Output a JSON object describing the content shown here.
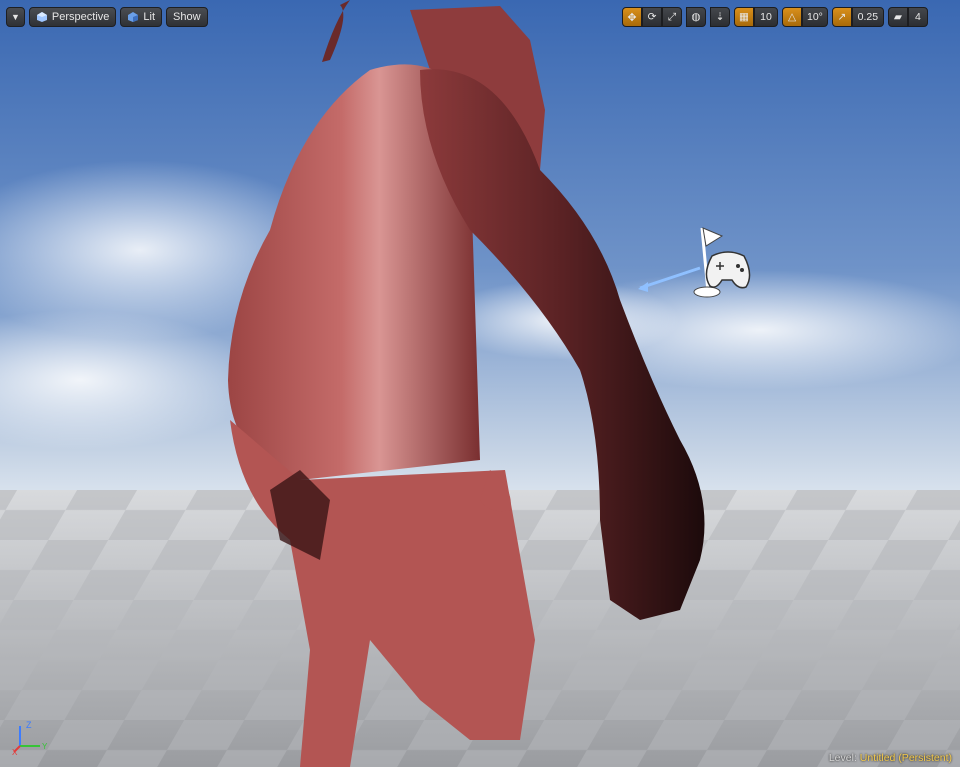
{
  "toolbar_left": {
    "menu_icon": "chevron-down-icon",
    "perspective_label": "Perspective",
    "lit_label": "Lit",
    "show_label": "Show"
  },
  "toolbar_right": {
    "grid_snap_value": "10",
    "rotation_snap_value": "10°",
    "scale_snap_value": "0.25",
    "camera_speed_value": "4"
  },
  "axis": {
    "z": "Z",
    "x": "X",
    "y": "Y"
  },
  "level": {
    "label": "Level:",
    "name": "Untitled (Persistent)"
  },
  "colors": {
    "sky_top": "#3f6fb7",
    "skin": "#b65a58",
    "accent_orange": "#d9901c",
    "level_name": "#f2c84a"
  }
}
